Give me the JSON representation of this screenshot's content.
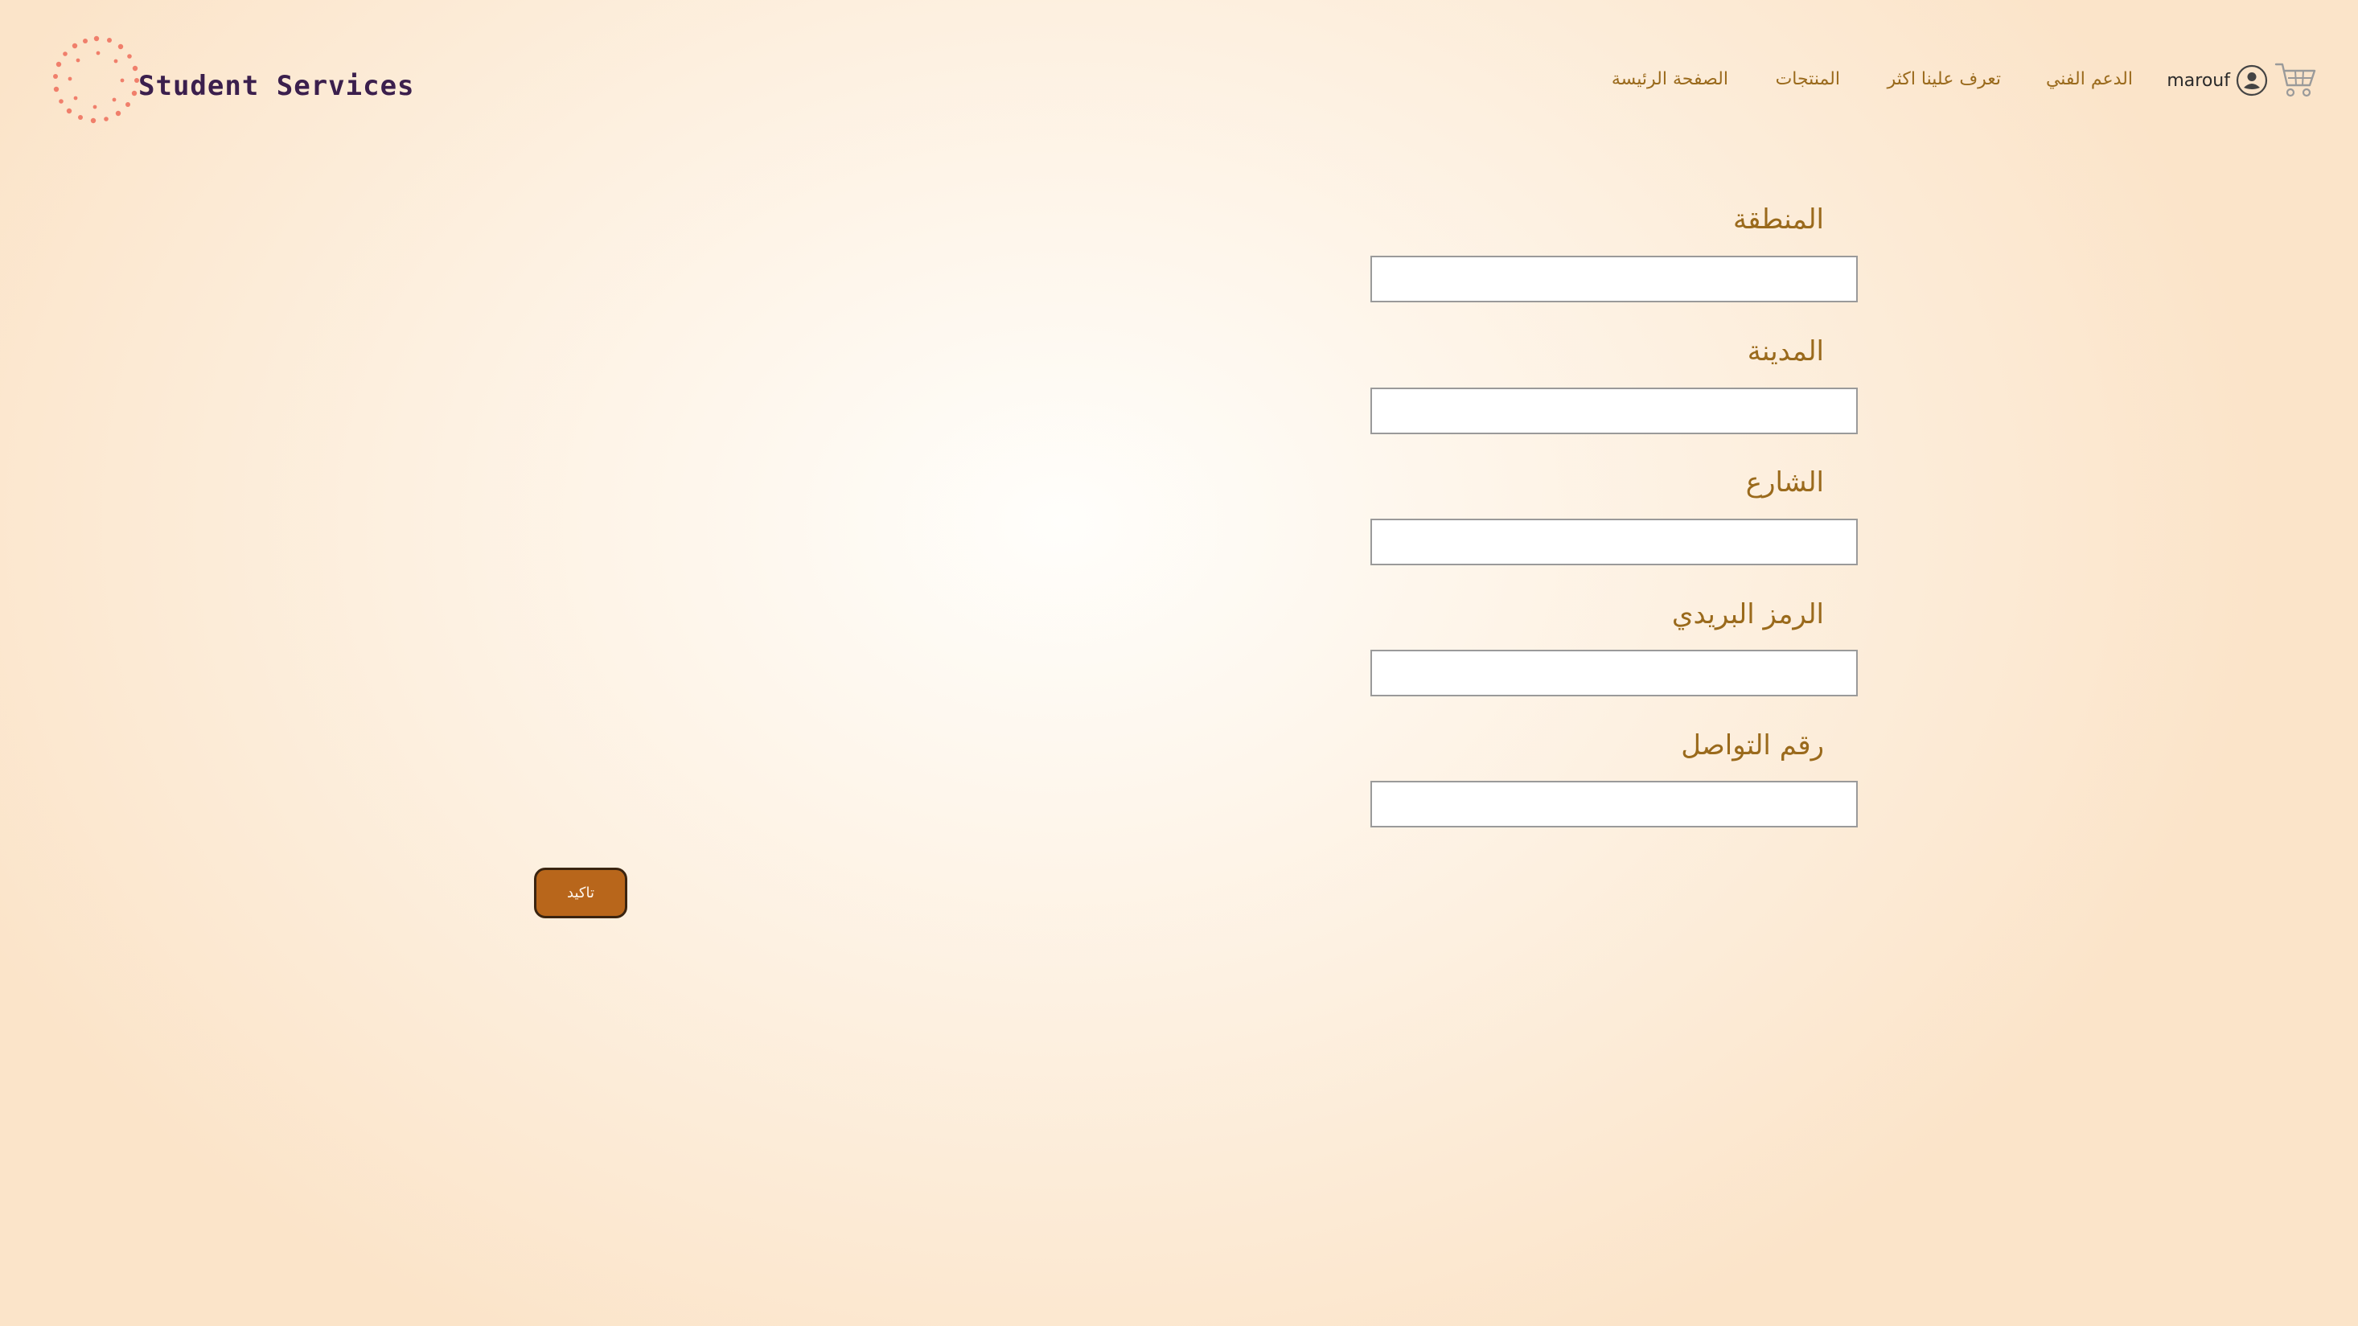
{
  "brand": {
    "name": "Student Services",
    "logo_icon": "dotted-circle-logo",
    "logo_color": "#f07f6b"
  },
  "nav": {
    "home": "الصفحة الرئيسة",
    "products": "المنتجات",
    "about": "تعرف علينا اكثر",
    "support": "الدعم الفني"
  },
  "user": {
    "name": "marouf",
    "icon": "user-circle-icon"
  },
  "cart": {
    "icon": "shopping-cart-icon"
  },
  "form": {
    "fields": [
      {
        "label": "المنطقة",
        "value": ""
      },
      {
        "label": "المدينة",
        "value": ""
      },
      {
        "label": "الشارع",
        "value": ""
      },
      {
        "label": "الرمز البريدي",
        "value": ""
      },
      {
        "label": "رقم التواصل",
        "value": ""
      }
    ],
    "submit_label": "تاكيد"
  },
  "colors": {
    "accent": "#9a6a1c",
    "button": "#b8661b",
    "brand_text": "#3b1f4d"
  }
}
